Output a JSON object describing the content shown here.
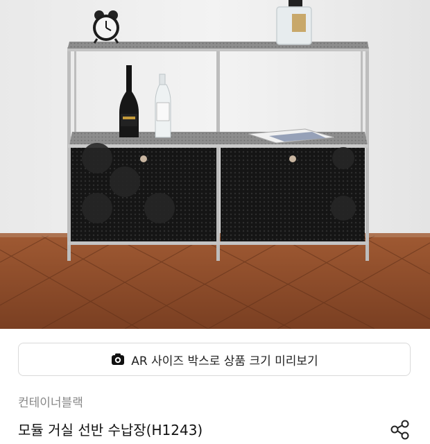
{
  "product_image": {
    "alt": ""
  },
  "ar_preview": {
    "label": "AR 사이즈 박스로 상품 크기 미리보기",
    "icon": "camera-icon"
  },
  "product": {
    "brand": "컨테이너블랙",
    "title": "모듈 거실 선반 수납장(H1243)"
  },
  "share": {
    "icon": "share-icon"
  },
  "colors": {
    "wall": "#eeeeee",
    "floor": "#8a4a2a",
    "cabinet": "#141414",
    "frame": "#b9b9b9",
    "text_primary": "#222222",
    "text_secondary": "#888888"
  }
}
